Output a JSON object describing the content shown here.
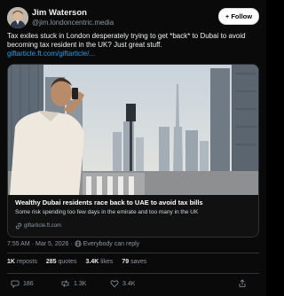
{
  "author": {
    "name": "Jim Waterson",
    "handle": "@jim.londoncentric.media"
  },
  "follow_label": "+ Follow",
  "tweet": {
    "text": "Tax exiles stuck in London desperately trying to get *back* to Dubai to avoid becoming tax resident in the UK? Just great stuff.",
    "link": "giftarticle.ft.com/giftarticle/..."
  },
  "card": {
    "title": "Wealthy Dubai residents race back to UAE to avoid tax bills",
    "description": "Some risk spending too few days in the emirate and too many in the UK",
    "source": "giftarticle.ft.com"
  },
  "meta": {
    "time": "7:55 AM",
    "date": "Mar 5, 2026",
    "reply_setting": "Everybody can reply"
  },
  "stats": {
    "reposts_count": "1K",
    "reposts_label": "reposts",
    "quotes_count": "285",
    "quotes_label": "quotes",
    "likes_count": "3.4K",
    "likes_label": "likes",
    "saves_count": "79",
    "saves_label": "saves"
  },
  "actions": {
    "replies": "186",
    "reposts": "1.3K",
    "likes": "3.4K"
  },
  "colors": {
    "background": "#0a0a0a",
    "link": "#1d9bf0",
    "muted": "#8b98a5"
  }
}
